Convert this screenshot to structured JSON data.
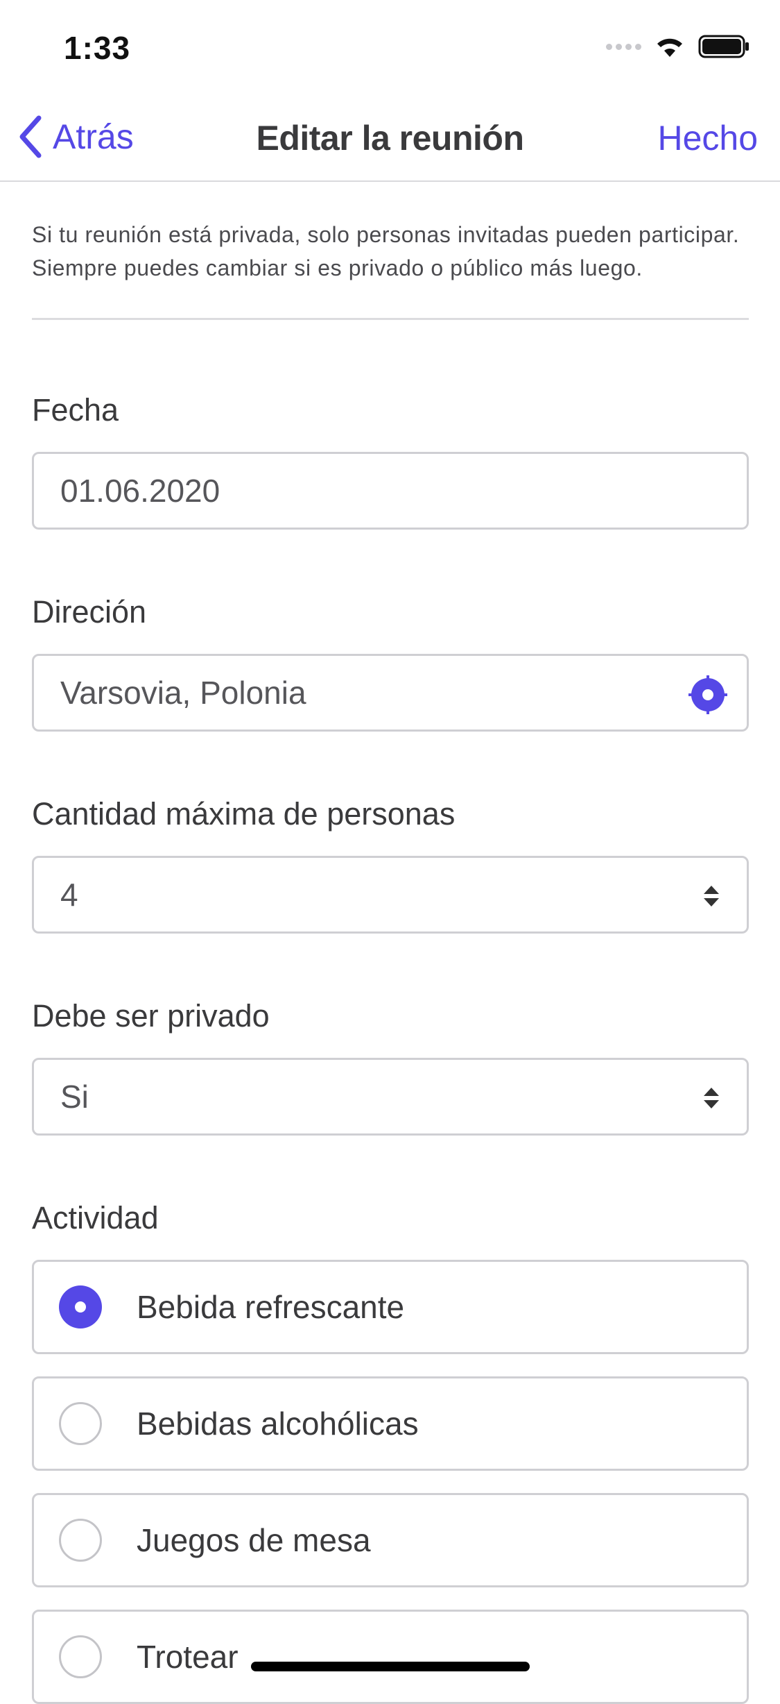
{
  "status_bar": {
    "time": "1:33"
  },
  "nav": {
    "back_label": "Atrás",
    "title": "Editar la reunión",
    "done_label": "Hecho"
  },
  "info_text": "Si tu reunión está privada, solo personas invitadas pueden participar. Siempre puedes cambiar si es privado o público más luego.",
  "form": {
    "date": {
      "label": "Fecha",
      "value": "01.06.2020"
    },
    "address": {
      "label": "Direción",
      "value": "Varsovia, Polonia",
      "icon": "locate-icon"
    },
    "max_people": {
      "label": "Cantidad máxima de personas",
      "value": "4"
    },
    "private": {
      "label": "Debe ser privado",
      "value": "Si"
    },
    "activity": {
      "label": "Actividad",
      "options": [
        {
          "label": "Bebida refrescante",
          "selected": true
        },
        {
          "label": "Bebidas alcohólicas",
          "selected": false
        },
        {
          "label": "Juegos de mesa",
          "selected": false
        },
        {
          "label": "Trotear",
          "selected": false
        }
      ]
    }
  },
  "colors": {
    "accent": "#5548e6",
    "border": "#cfcfd3",
    "text": "#3a3a3c"
  }
}
